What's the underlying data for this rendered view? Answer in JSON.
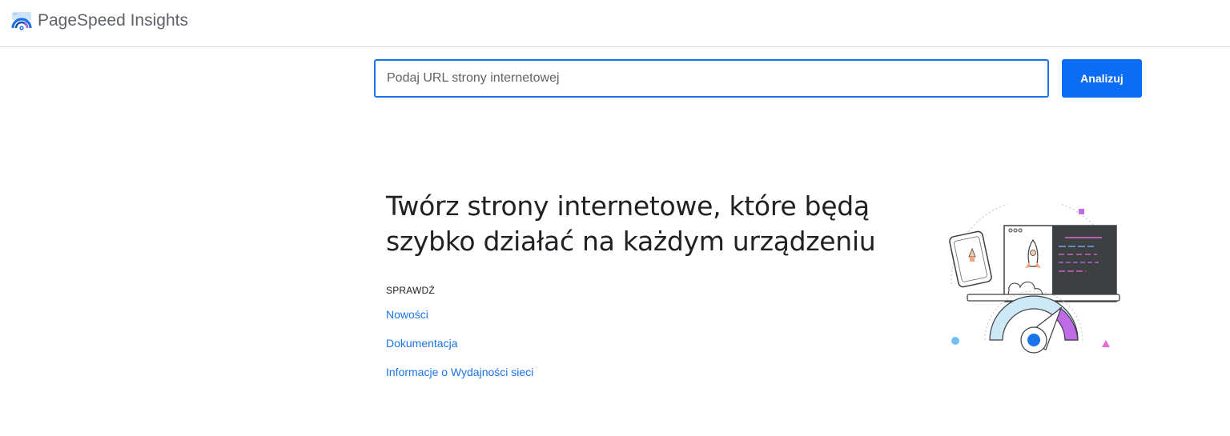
{
  "header": {
    "app_name": "PageSpeed Insights",
    "logo_icon": "pagespeed-logo-icon"
  },
  "search": {
    "placeholder": "Podaj URL strony internetowej",
    "value": "",
    "button_label": "Analizuj"
  },
  "hero": {
    "title_line1": "Twórz strony internetowe, które będą",
    "title_line2": "szybko działać na każdym urządzeniu",
    "section_label": "SPRAWDŹ",
    "links": [
      {
        "label": "Nowości"
      },
      {
        "label": "Dokumentacja"
      },
      {
        "label": "Informacje o Wydajności sieci"
      }
    ],
    "illustration_icon": "speed-gauge-devices-illustration"
  },
  "colors": {
    "accent": "#1a73e8",
    "button": "#0b6cf5",
    "gauge_purple": "#c06ce8",
    "gauge_light": "#cde8f6",
    "gauge_dot": "#1a73e8"
  }
}
